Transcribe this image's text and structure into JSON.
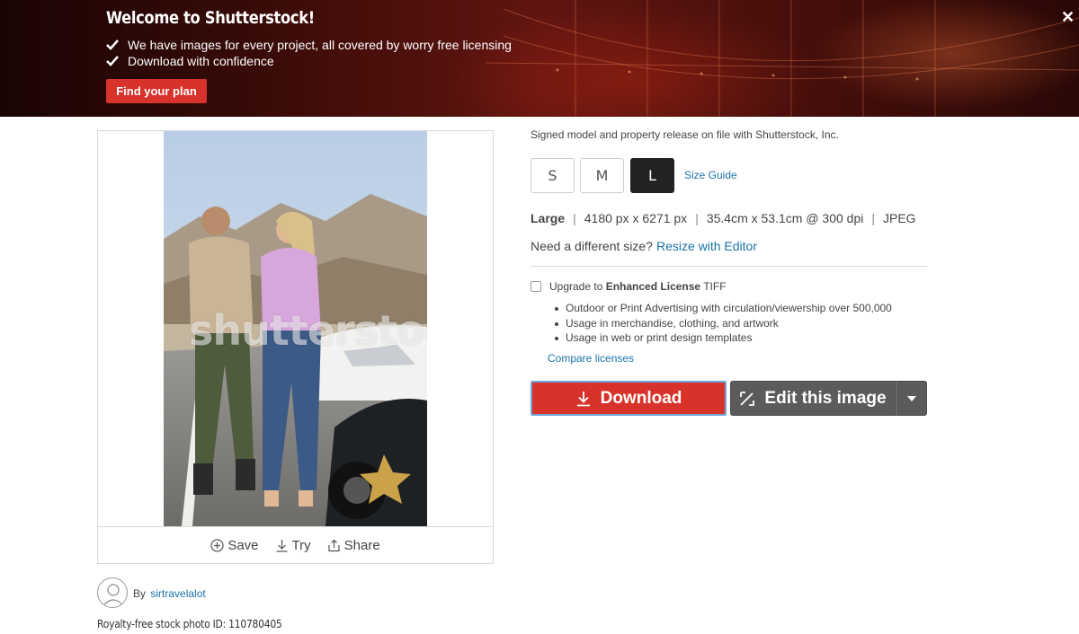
{
  "banner": {
    "title": "Welcome to Shutterstock!",
    "lines": [
      "We have images for every project, all covered by worry free licensing",
      "Download with confidence"
    ],
    "cta_label": "Find your plan",
    "close_glyph": "✕"
  },
  "image_card": {
    "watermark": "shutterstock",
    "actions": [
      {
        "label": "Save",
        "icon": "plus-circle-icon"
      },
      {
        "label": "Try",
        "icon": "download-arrow-icon"
      },
      {
        "label": "Share",
        "icon": "share-icon"
      }
    ]
  },
  "author": {
    "by_label": "By",
    "name": "sirtravelalot"
  },
  "photo_id_text": "Royalty-free stock photo ID: 110780405",
  "details": {
    "release_text": "Signed model and property release on file with Shutterstock, Inc.",
    "sizes": [
      "S",
      "M",
      "L"
    ],
    "selected_size": "L",
    "size_guide_label": "Size Guide",
    "spec": {
      "size_name": "Large",
      "pixels": "4180 px x 6271 px",
      "physical": "35.4cm x 53.1cm @ 300 dpi",
      "format": "JPEG",
      "separator": "|"
    },
    "need_text": "Need a different size?",
    "resize_label": "Resize with Editor",
    "upgrade": {
      "prefix": "Upgrade to",
      "bold": "Enhanced License",
      "suffix": "TIFF",
      "checked": false,
      "bullets": [
        "Outdoor or Print Advertising with circulation/viewership over 500,000",
        "Usage in merchandise, clothing, and artwork",
        "Usage in web or print design templates"
      ]
    },
    "compare_label": "Compare licenses",
    "download_label": "Download",
    "edit_label": "Edit this image"
  },
  "colors": {
    "accent_red": "#d8332b",
    "link_blue": "#1a73a8",
    "edit_gray": "#5b5b5b"
  }
}
